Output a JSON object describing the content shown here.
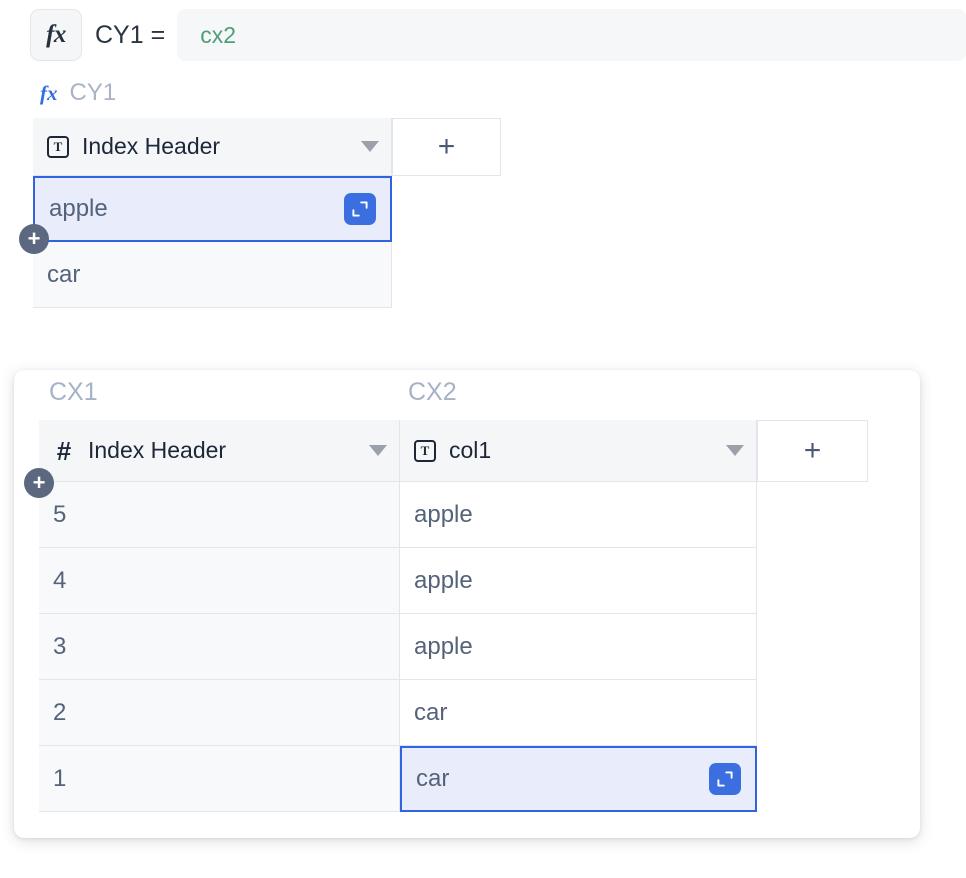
{
  "formula_bar": {
    "fx_icon": "fx-icon",
    "reference": "CY1 =",
    "value": "cx2",
    "placeholder": ""
  },
  "sub_reference": {
    "fx_icon": "fx-icon",
    "label": "CY1"
  },
  "table1": {
    "columns": [
      {
        "type_icon": "text-type-icon",
        "type_glyph": "T",
        "label": "Index Header",
        "has_dropdown": true
      }
    ],
    "add_column_label": "+",
    "add_row_label": "+",
    "rows": [
      {
        "value": "apple",
        "selected": true,
        "expand_label": "expand-icon"
      },
      {
        "value": "car",
        "selected": false
      }
    ]
  },
  "table2": {
    "column_refs": [
      "CX1",
      "CX2"
    ],
    "columns": [
      {
        "type_icon": "number-type-icon",
        "type_glyph": "#",
        "label": "Index Header",
        "has_dropdown": true
      },
      {
        "type_icon": "text-type-icon",
        "type_glyph": "T",
        "label": "col1",
        "has_dropdown": true
      }
    ],
    "add_column_label": "+",
    "add_row_label": "+",
    "rows": [
      {
        "index": "5",
        "col1": "apple",
        "selected": false
      },
      {
        "index": "4",
        "col1": "apple",
        "selected": false
      },
      {
        "index": "3",
        "col1": "apple",
        "selected": false
      },
      {
        "index": "2",
        "col1": "car",
        "selected": false
      },
      {
        "index": "1",
        "col1": "car",
        "selected": true,
        "expand_label": "expand-icon"
      }
    ]
  },
  "colors": {
    "accent_blue": "#3b6fe0",
    "selection_border": "#2f63e0",
    "selection_fill": "#e9edfb",
    "formula_green": "#4e9e77",
    "muted_ref": "#a6b2c6",
    "badge_slate": "#5c6880"
  }
}
